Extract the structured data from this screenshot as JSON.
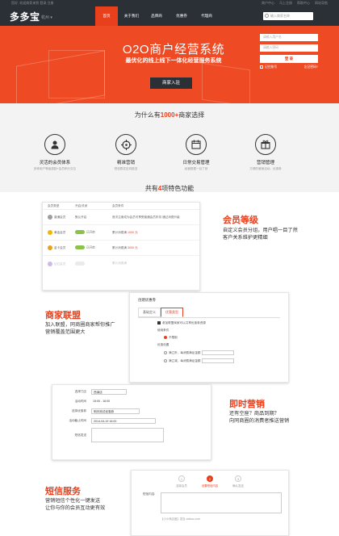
{
  "topbar": {
    "left": "您好, 欢迎商家来到 登录  注册",
    "right": [
      "商户中心",
      "马上注册",
      "帮助中心",
      "网站导航"
    ]
  },
  "nav": {
    "logo": "多多宝",
    "city": "杭州 ▾",
    "links": [
      "首页",
      "关于我们",
      "品牌商",
      "优惠券",
      "代理商"
    ],
    "search_placeholder": "输入商家名称"
  },
  "hero": {
    "title": "O2O商户经营系统",
    "subtitle": "最优化的线上线下一体化经营服务系统",
    "cta": "商家入驻",
    "login": {
      "username_placeholder": "请输入用户名",
      "password_placeholder": "请输入密码",
      "submit": "登 录",
      "remember": "记住账号",
      "forgot": "忘记密码?"
    }
  },
  "why": {
    "title_pre": "为什么有",
    "title_num": "1000+",
    "title_post": "商家选择",
    "features": [
      {
        "icon": "user-icon",
        "title": "灵活的会员体系",
        "desc": "多种用户等级激励+会员积分交互"
      },
      {
        "icon": "target-icon",
        "title": "精准营销",
        "desc": "短信群发定向推送"
      },
      {
        "icon": "calendar-icon",
        "title": "日常交易管理",
        "desc": "经营数据一目了然"
      },
      {
        "icon": "gift-icon",
        "title": "营销管理",
        "desc": "方便的营销活动，优惠券"
      }
    ]
  },
  "special": {
    "title_pre": "共有",
    "title_num": "4",
    "title_post": "项特色功能"
  },
  "member": {
    "heading": "会员等级",
    "desc": [
      "自定义会员分组，用户唱一目了然",
      "客户关系维护更精细"
    ],
    "table_headers": [
      "会员类型",
      "开启/关闭",
      "会员条件"
    ],
    "rows": [
      {
        "name": "普通会员",
        "status": "默认开启",
        "cond": "首次注册成为会员可享受普通会员折扣 通过消费升级"
      },
      {
        "name": "黄金会员",
        "status": "已开启",
        "cond": "累计消费满",
        "amount": "1000",
        "unit": "元"
      },
      {
        "name": "金卡会员",
        "status": "已开启",
        "cond": "累计消费满",
        "amount": "3000",
        "unit": "元"
      },
      {
        "name": "钻石会员",
        "status": "",
        "cond": "累计消费满",
        "amount": "",
        "unit": ""
      }
    ]
  },
  "alliance": {
    "heading": "商家联盟",
    "desc": [
      "加入联盟，同商圈商家帮你推广",
      "营销覆盖范围更大"
    ]
  },
  "coupon": {
    "title": "创建优惠券",
    "tabs": [
      "基础定义",
      "优惠类型"
    ],
    "lines": [
      "参加联盟商家可以共享优惠券资源",
      "使用条件",
      "不限制",
      "优惠设置",
      "满立折，每消费满足金额",
      "满立减，每消费满足金额"
    ]
  },
  "instant": {
    "heading": "即时营销",
    "desc": [
      "还有空座？商品到期？",
      "向同商圈的消费者推送营销"
    ]
  },
  "form": {
    "rows": [
      {
        "label": "选择门店",
        "value": "西溪店"
      },
      {
        "label": "活动时间",
        "value": "15:00  -  16:00"
      },
      {
        "label": "选择优惠券",
        "value": "明天测试优惠券"
      },
      {
        "label": "活动截止时间",
        "value": "2014-04-19     16:00"
      },
      {
        "label": "短信发送",
        "value": ""
      }
    ]
  },
  "sms": {
    "heading": "短信服务",
    "desc": [
      "营销短信个性化一键发送",
      "让你与你的会员互动更有效"
    ],
    "steps": [
      "选择会员",
      "设置短信内容",
      "确认发送"
    ],
    "footer": "【小小商店度】发自 dotbao.com"
  }
}
